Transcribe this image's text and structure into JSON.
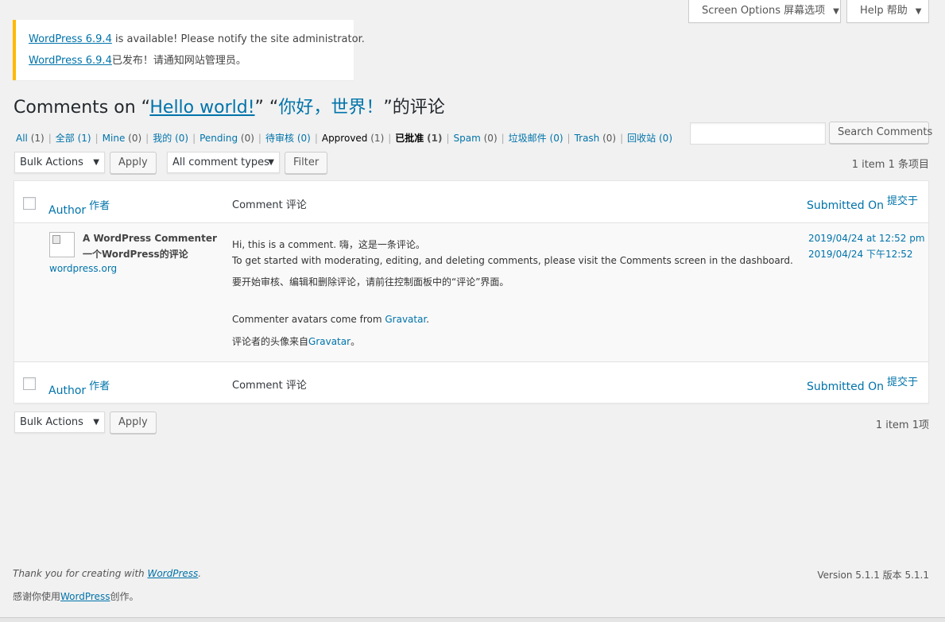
{
  "top_tabs": {
    "screen_options": "Screen Options 屏幕选项",
    "help": "Help 帮助"
  },
  "notice": {
    "link_version": "WordPress 6.9.4",
    "text_en": " is available! Please notify the site administrator.",
    "text_zh": "已发布！请通知网站管理员。"
  },
  "heading": {
    "prefix": "Comments on “",
    "post_en": "Hello world!",
    "mid": "” “",
    "post_zh": "你好，世界！",
    "suffix": "”的评论"
  },
  "filters": [
    {
      "label": "All",
      "count": "(1)",
      "current": false
    },
    {
      "label": "全部",
      "count": "(1)",
      "current": false,
      "count_link": true
    },
    {
      "label": "Mine",
      "count": "(0)",
      "current": false
    },
    {
      "label": "我的",
      "count": "(0)",
      "current": false,
      "count_link": true
    },
    {
      "label": "Pending",
      "count": "(0)",
      "current": false
    },
    {
      "label": "待审核",
      "count": "(0)",
      "current": false,
      "count_link": true
    },
    {
      "label": "Approved",
      "count": "(1)",
      "current": true
    },
    {
      "label": "已批准",
      "count": "(1)",
      "current": true,
      "bold": true
    },
    {
      "label": "Spam",
      "count": "(0)",
      "current": false
    },
    {
      "label": "垃圾邮件",
      "count": "(0)",
      "current": false,
      "count_link": true
    },
    {
      "label": "Trash",
      "count": "(0)",
      "current": false
    },
    {
      "label": "回收站",
      "count": "(0)",
      "current": false,
      "count_link": true
    }
  ],
  "search": {
    "placeholder": "",
    "button": "Search Comments"
  },
  "toolbar": {
    "bulk_actions": "Bulk Actions",
    "apply": "Apply",
    "comment_types": "All comment types",
    "filter": "Filter",
    "count_top": "1 item 1 条项目",
    "count_bottom": "1 item 1项"
  },
  "columns": {
    "author_en": "Author",
    "author_zh": "作者",
    "comment": "Comment 评论",
    "submitted_en": "Submitted On",
    "submitted_zh": "提交于"
  },
  "comment": {
    "author_en": "A WordPress Commenter",
    "author_zh": "一个WordPress的评论",
    "author_url": "wordpress.org",
    "line1": "Hi, this is a comment. 嗨，这是一条评论。",
    "line2": "To get started with moderating, editing, and deleting comments, please visit the Comments screen in the dashboard.",
    "line3": "要开始审核、编辑和删除评论，请前往控制面板中的“评论”界面。",
    "line4_prefix": "Commenter avatars come from ",
    "line4_link": "Gravatar",
    "line4_suffix": ".",
    "line5_prefix": "评论者的头像来自",
    "line5_link": "Gravatar",
    "line5_suffix": "。",
    "date_en": "2019/04/24 at 12:52 pm",
    "date_zh": "2019/04/24 下午12:52"
  },
  "footer": {
    "thanks_prefix": "Thank you for creating with ",
    "thanks_link": "WordPress",
    "thanks_suffix": ".",
    "thanks_zh_prefix": "感谢你使用",
    "thanks_zh_link": "WordPress",
    "thanks_zh_suffix": "创作。",
    "version": "Version 5.1.1 版本 5.1.1"
  }
}
